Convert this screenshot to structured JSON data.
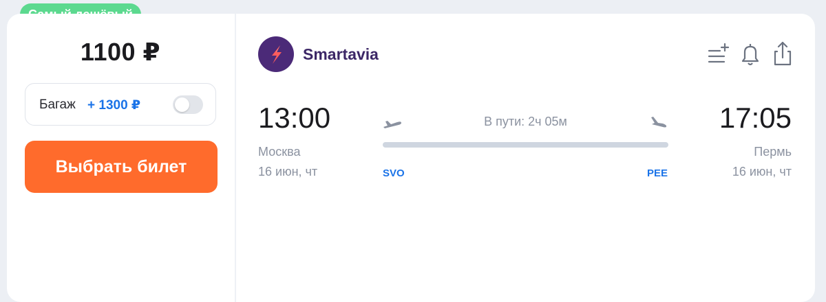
{
  "badge": {
    "label": "Самый дешёвый",
    "color": "#5cd98f"
  },
  "price": {
    "value": "1100 ₽"
  },
  "baggage": {
    "label": "Багаж",
    "price": "+ 1300 ₽",
    "toggle_on": false
  },
  "buy_button": {
    "label": "Выбрать билет",
    "color": "#ff6b2c"
  },
  "airline": {
    "name": "Smartavia",
    "logo_color": "#4b2a78"
  },
  "actions": {
    "icons": [
      "add-to-list-icon",
      "bell-icon",
      "share-icon"
    ]
  },
  "flight": {
    "duration": "В пути: 2ч 05м",
    "departure": {
      "time": "13:00",
      "city": "Москва",
      "date": "16 июн, чт",
      "iata": "SVO"
    },
    "arrival": {
      "time": "17:05",
      "city": "Пермь",
      "date": "16 июн, чт",
      "iata": "PEE"
    }
  }
}
